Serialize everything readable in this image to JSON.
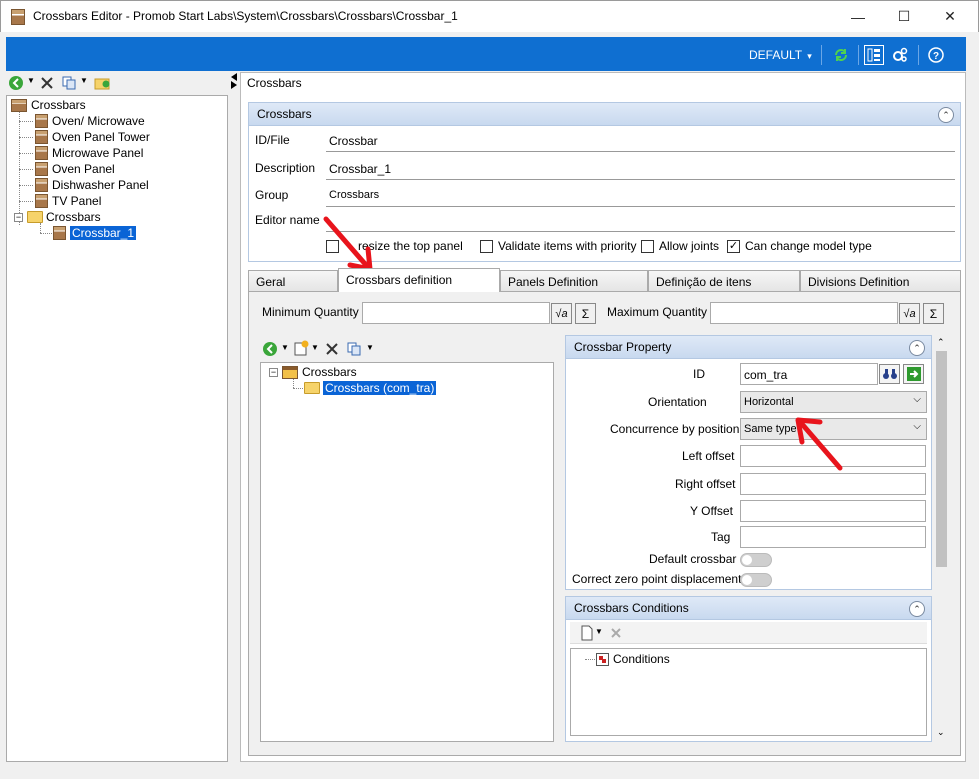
{
  "window": {
    "title": "Crossbars Editor - Promob Start Labs\\System\\Crossbars\\Crossbars\\Crossbar_1",
    "minimize": "—",
    "maximize": "☐",
    "close": "✕"
  },
  "ribbon": {
    "profile_label": "DEFAULT",
    "dropdown_glyph": "▾"
  },
  "left_tree": {
    "root": "Crossbars",
    "items": [
      "Oven/ Microwave",
      "Oven Panel Tower",
      "Microwave Panel",
      "Oven Panel",
      "Dishwasher Panel",
      "TV Panel"
    ],
    "folder": "Crossbars",
    "folder_child": "Crossbar_1",
    "expander_minus": "−"
  },
  "breadcrumb": "Crossbars",
  "top_panel": {
    "title": "Crossbars",
    "fields": {
      "id_label": "ID/File",
      "id_value": "Crossbar",
      "description_label": "Description",
      "description_value": "Crossbar_1",
      "group_label": "Group",
      "group_value": "Crossbars",
      "editor_label": "Editor name",
      "editor_value": ""
    },
    "checkboxes": [
      {
        "label": "Can resize the top panel",
        "visible_label": "resize the top panel",
        "checked": false
      },
      {
        "label": "Validate items with priority",
        "checked": false
      },
      {
        "label": "Allow joints",
        "checked": false
      },
      {
        "label": "Can change model type",
        "checked": true
      }
    ]
  },
  "tabs": [
    "Geral",
    "Crossbars definition",
    "Panels Definition",
    "Definição de itens",
    "Divisions Definition"
  ],
  "active_tab": "Crossbars definition",
  "quantity": {
    "min_label": "Minimum Quantity",
    "max_label": "Maximum Quantity",
    "sigma": "Σ",
    "sqrt": "√a"
  },
  "def_tree": {
    "root": "Crossbars",
    "child": "Crossbars (com_tra)",
    "expander_minus": "−"
  },
  "property": {
    "title": "Crossbar Property",
    "id_label": "ID",
    "id_value": "com_tra",
    "orientation_label": "Orientation",
    "orientation_value": "Horizontal",
    "concurrence_label": "Concurrence by position",
    "concurrence_value": "Same type",
    "left_offset_label": "Left offset",
    "right_offset_label": "Right offset",
    "y_offset_label": "Y Offset",
    "tag_label": "Tag",
    "default_crossbar_label": "Default crossbar",
    "zero_point_label": "Correct zero point displacement",
    "default_crossbar_on": false,
    "zero_point_on": false
  },
  "conditions": {
    "title": "Crossbars Conditions",
    "node": "Conditions"
  },
  "colors": {
    "ribbon": "#0f6fd1",
    "selection": "#0a64d6",
    "annotation_arrow": "#e8141c"
  }
}
